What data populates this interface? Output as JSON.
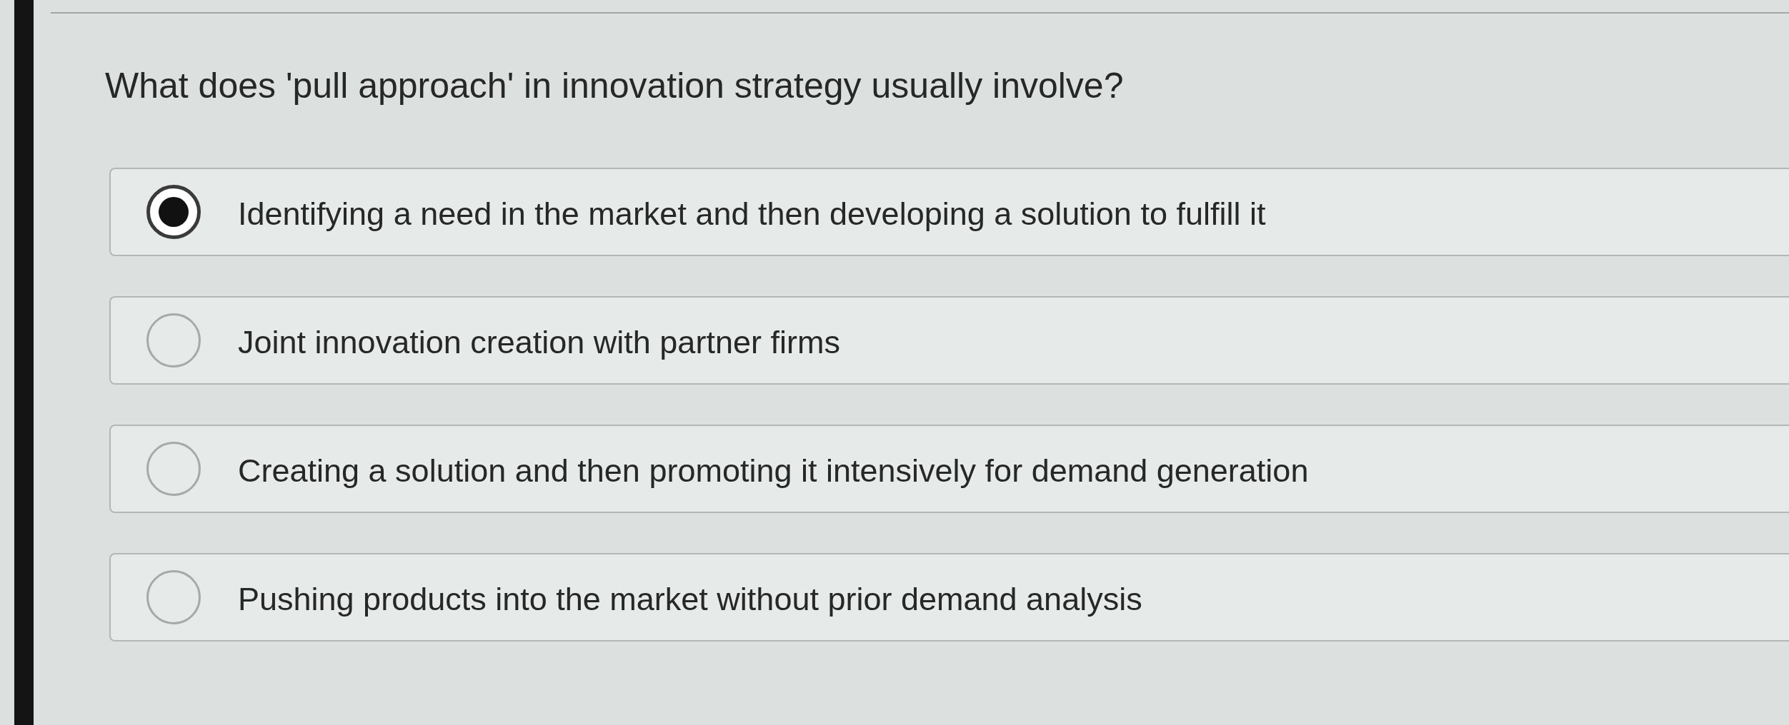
{
  "question": {
    "text": "What does 'pull approach' in innovation strategy usually involve?"
  },
  "options": [
    {
      "label": "Identifying a need in the market and then developing a solution to fulfill it",
      "selected": true
    },
    {
      "label": "Joint innovation creation with partner firms",
      "selected": false
    },
    {
      "label": "Creating a solution and then promoting it intensively for demand generation",
      "selected": false
    },
    {
      "label": "Pushing products into the market without prior demand analysis",
      "selected": false
    }
  ]
}
